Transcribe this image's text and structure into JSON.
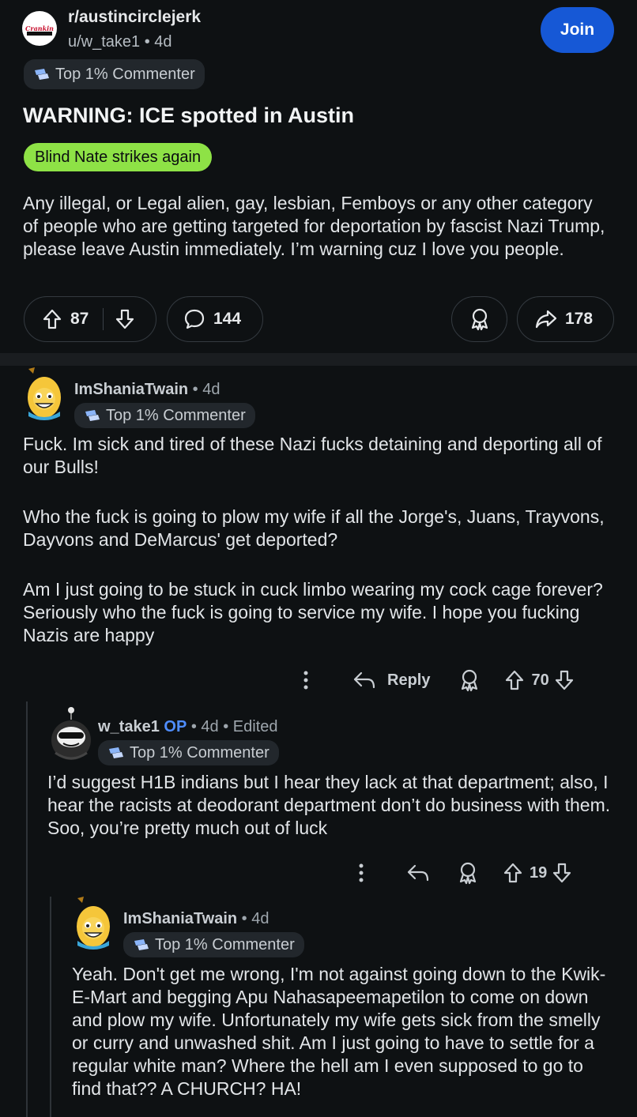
{
  "post": {
    "subreddit": "r/austincirclejerk",
    "author": "u/w_take1",
    "age": "4d",
    "join_label": "Join",
    "badge": "Top 1% Commenter",
    "title": "WARNING: ICE spotted in Austin",
    "flair": "Blind Nate strikes again",
    "body": "Any illegal, or Legal alien, gay, lesbian, Femboys or any other category of people who are getting targeted for deportation by fascist Nazi Trump, please leave Austin immediately. I’m warning cuz I love you people.",
    "votes": "87",
    "comments": "144",
    "shares": "178",
    "flair_color": "#8ee246",
    "join_color": "#1658d6"
  },
  "comments": [
    {
      "user": "ImShaniaTwain",
      "meta": " • 4d",
      "badge": "Top 1% Commenter",
      "paragraphs": [
        "Fuck. Im sick and tired of these Nazi fucks detaining and deporting all of our Bulls!",
        "Who the fuck is going to plow my wife if all the Jorge's, Juans, Trayvons, Dayvons and DeMarcus' get deported?",
        "Am I just going to be stuck in cuck limbo wearing my cock cage forever? Seriously who the fuck is going to service my wife. I hope you fucking Nazis are happy"
      ],
      "reply_label": "Reply",
      "votes": "70"
    },
    {
      "user": "w_take1",
      "op_label": "OP",
      "meta": " • 4d • Edited",
      "badge": "Top 1% Commenter",
      "body": "I’d suggest H1B indians but I hear they lack at that department; also, I hear the racists at deodorant department don’t do business with them. Soo, you’re pretty much out of luck",
      "votes": "19"
    },
    {
      "user": "ImShaniaTwain",
      "meta": " • 4d",
      "badge": "Top 1% Commenter",
      "body": "Yeah. Don't get me wrong, I'm not against going down to the Kwik-E-Mart and begging Apu Nahasapeemapetilon to come on down and plow my wife. Unfortunately my wife gets sick from the smelly or curry and unwashed shit. Am I just going to have to settle for a regular white man? Where the hell am I even supposed to go to find that?? A CHURCH? HA!"
    }
  ]
}
